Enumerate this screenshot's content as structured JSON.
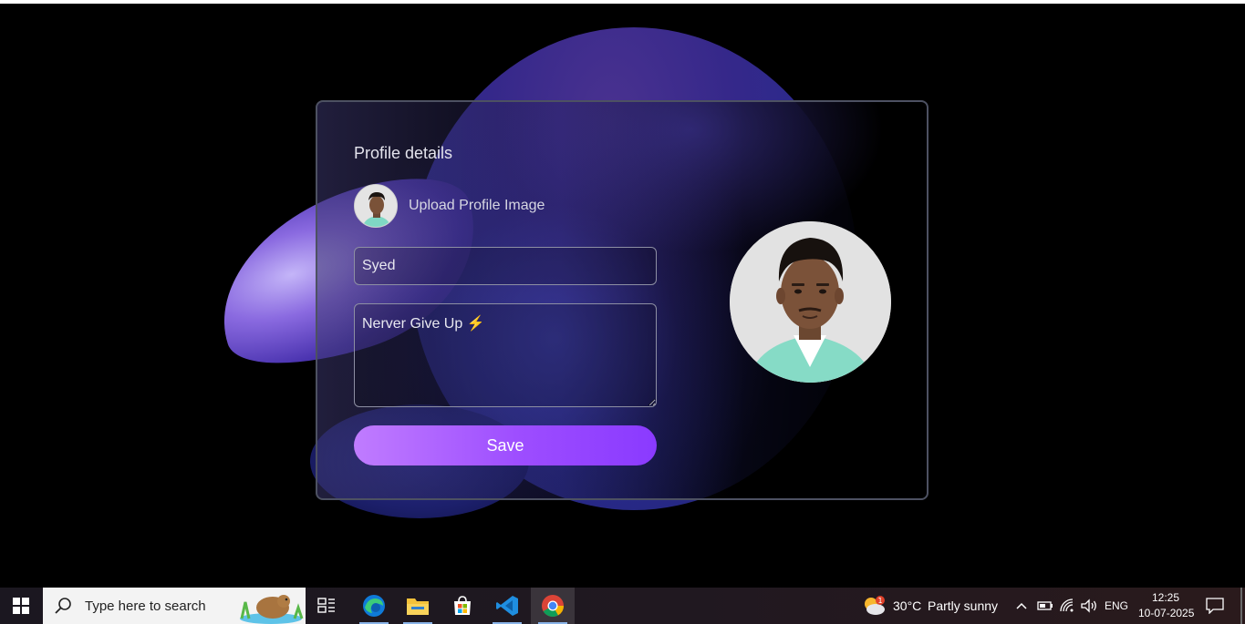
{
  "profile": {
    "title": "Profile details",
    "upload_label": "Upload Profile Image",
    "name_value": "Syed",
    "bio_value": "Nerver Give Up ⚡",
    "save_label": "Save"
  },
  "taskbar": {
    "search_placeholder": "Type here to search",
    "pinned_apps": [
      {
        "name": "task-view-icon"
      },
      {
        "name": "edge-icon"
      },
      {
        "name": "file-explorer-icon"
      },
      {
        "name": "microsoft-store-icon"
      },
      {
        "name": "vscode-icon"
      },
      {
        "name": "chrome-icon"
      }
    ],
    "weather": {
      "temp": "30°C",
      "condition": "Partly sunny"
    },
    "language": "ENG",
    "time": "12:25",
    "date": "10-07-2025"
  },
  "colors": {
    "accent_start": "#c07cff",
    "accent_end": "#8a3aff",
    "card_border": "#4d5162"
  }
}
